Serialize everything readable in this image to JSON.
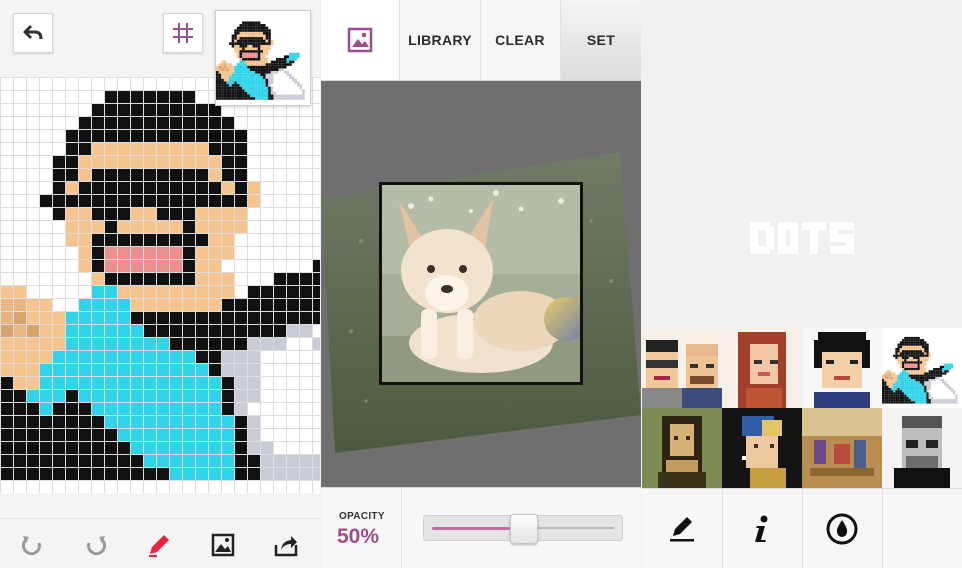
{
  "editor": {
    "tools": [
      "undo-icon",
      "redo-icon",
      "pencil-icon",
      "image-icon",
      "share-icon"
    ],
    "accent": "#e8253a",
    "palette": {
      "b": "#111111",
      "s": "#f6c48f",
      "m": "#d9a36b",
      "l": "#e8b682",
      "c": "#2fd4ea",
      "p": "#ec8f8f",
      "w": "#ffffff",
      "g": "#c9ccd6"
    },
    "sprite": [
      "....................................",
      "....................................",
      "..........bbbbbbb...................",
      ".........bbbbbbbbbb.................",
      "........bbbbbbbbbbbb................",
      ".......bbbbbbbbbbbbbb...............",
      ".......bbsssssssssbbb...............",
      "......bbsssssssssssbb...............",
      "......bbsbbbbbbbbbsbb...............",
      "......bsbbbbbbbbbbbsbs..............",
      ".....bbbbbbbbbbbbbbbbs..............",
      "......bssbbbssbbbssss...............",
      ".......sssbsssssbssss...............",
      ".......ssbbbbbbbbbss................",
      "........sbppppppbsss........cccc....",
      "........sbppppppbss.......bbcccc....",
      ".........sbbbbbbbsss...bbbbcccc.....",
      "..ss.....ccsssssssss.bbbbbbcbb......",
      ".sllss..ccccsssssssbbbbbbbbbb.......",
      "smlmssscccccbbbbbbbbbbbbbbb.........",
      "slmlmssccccccbbbbbbbbbbbgg..........",
      "bssssssccccccccbbbbbbgggwwgg........",
      "bbsssscccccccccccbbgggwwwwwgg.......",
      "bbssscccccccccccccbgggwwwwwwgg......",
      "bbbssccccccccccccccbggwwwwwwwgg.....",
      "bbbbcccbcccccccccccbggwwwwwwwwgg....",
      "bbbbbcbbbccccccccccbgwwwwwwwwwwgg...",
      "bbbbbbbbbbccccccccccbgwwwwwwwwwwg...",
      "bbbbbbbbbbbcccccccccbgwwwwwwwwwwwg..",
      "bbbbbbbbbbbbccccccccbggwwwwwwwwwwg..",
      "bbbbbbbbbbbbbcccccccbbgggggggggggg..",
      "bbbbbbbbbbbbbbbcccccbbgggggggggggg.."
    ]
  },
  "importer": {
    "tabs": {
      "library": "LIBRARY",
      "clear": "CLEAR",
      "set": "SET"
    },
    "opacity_label": "OPACITY",
    "opacity_value": "50%",
    "opacity": 0.5,
    "accent": "#9b4f8e"
  },
  "gallery": {
    "logo_text": "DOTS",
    "items": [
      "two-men-portrait",
      "red-hair-woman",
      "man-with-bowl-cut",
      "psy-dance",
      "mona-lisa",
      "girl-with-pearl-earring",
      "the-gleaners",
      "steve-jobs"
    ],
    "actions": [
      "pencil-icon",
      "info-icon",
      "ink-drop-icon"
    ]
  }
}
